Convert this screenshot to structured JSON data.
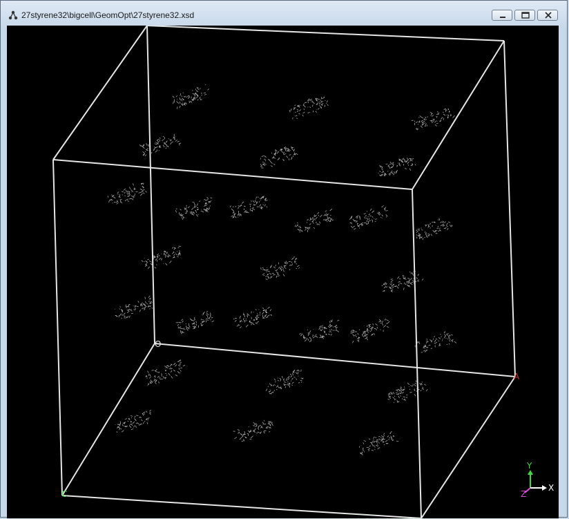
{
  "window": {
    "title": "27styrene32\\bigcell\\GeomOpt\\27styrene32.xsd",
    "icon": "molecule-document-icon"
  },
  "controls": {
    "minimize_icon": "minimize-icon",
    "maximize_icon": "maximize-icon",
    "close_icon": "close-icon"
  },
  "scene": {
    "background": "#000000",
    "cell_edge_color": "#e6e6e6",
    "atom_color": "#d0d0d0",
    "cell_labels": {
      "origin": "O",
      "a": "A",
      "c": "C"
    },
    "axes": {
      "x_label": "X",
      "y_label": "Y",
      "z_label": "Z",
      "x_color": "#ffffff",
      "y_color": "#3ddc3d",
      "z_color": "#d94cd9"
    },
    "molecule_count": 27
  }
}
